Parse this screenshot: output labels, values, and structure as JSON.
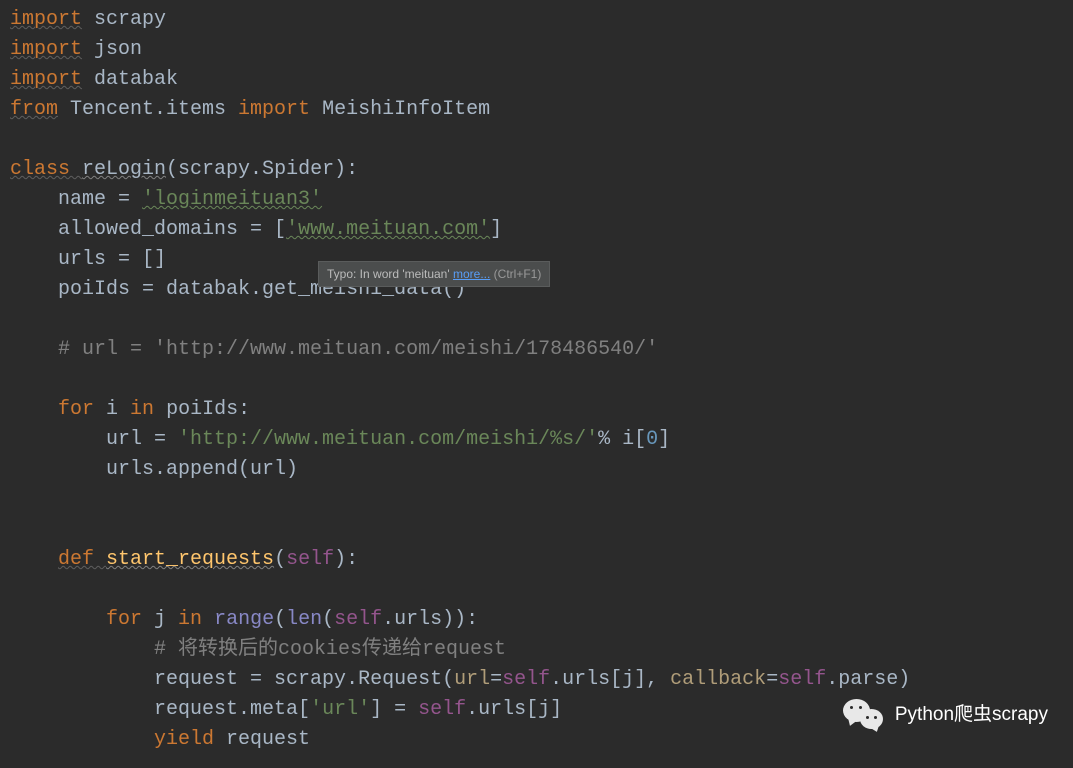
{
  "code": {
    "line1": {
      "kw1": "import",
      "id1": " scrapy"
    },
    "line2": {
      "kw1": "import",
      "id1": " json"
    },
    "line3": {
      "kw1": "import",
      "id1": " databak"
    },
    "line4": {
      "kw1": "from",
      "id1": " Tencent.items ",
      "kw2": "import",
      "id2": " MeishiInfoItem"
    },
    "line6": {
      "kw1": "class ",
      "cls": "reLogin",
      "paren1": "(",
      "base": "scrapy.Spider",
      "paren2": "):"
    },
    "line7": {
      "indent": "    ",
      "var": "name = ",
      "str": "'loginmeituan3'"
    },
    "line8": {
      "indent": "    ",
      "var": "allowed_domains = [",
      "str": "'www.meituan.com'",
      "close": "]"
    },
    "line9": {
      "indent": "    ",
      "var": "urls = []"
    },
    "line10": {
      "indent": "    ",
      "var": "poiIds = databak.get_meishi_data()"
    },
    "line12": {
      "indent": "    ",
      "comment": "# url = 'http://www.meituan.com/meishi/178486540/'"
    },
    "line14": {
      "indent": "    ",
      "kw1": "for ",
      "var1": "i ",
      "kw2": "in ",
      "var2": "poiIds:"
    },
    "line15": {
      "indent": "        ",
      "var": "url = ",
      "str": "'http://www.meituan.com/meishi/%s/'",
      "op": "% i[",
      "num": "0",
      "close": "]"
    },
    "line16": {
      "indent": "        ",
      "var": "urls.append(url)"
    },
    "line19": {
      "indent": "    ",
      "kw1": "def ",
      "fn": "start_requests",
      "paren1": "(",
      "self": "self",
      "paren2": "):"
    },
    "line21": {
      "indent": "        ",
      "kw1": "for ",
      "var1": "j ",
      "kw2": "in ",
      "builtin": "range",
      "paren1": "(",
      "builtin2": "len",
      "paren2": "(",
      "self": "self",
      "attr": ".urls)):"
    },
    "line22": {
      "indent": "            ",
      "comment": "# 将转换后的cookies传递给request"
    },
    "line23": {
      "indent": "            ",
      "var1": "request = scrapy.Request(",
      "kw1": "url",
      "eq1": "=",
      "self1": "self",
      "attr1": ".urls[j]",
      "comma": ", ",
      "kw2": "callback",
      "eq2": "=",
      "self2": "self",
      "attr2": ".parse)"
    },
    "line24": {
      "indent": "            ",
      "var1": "request.meta[",
      "str": "'url'",
      "close1": "] = ",
      "self": "self",
      "attr": ".urls[j]"
    },
    "line25": {
      "indent": "            ",
      "kw1": "yield ",
      "var": "request"
    }
  },
  "tooltip": {
    "prefix": "Typo: In word 'meituan' ",
    "link": "more...",
    "shortcut": " (Ctrl+F1)"
  },
  "watermark": {
    "text": "Python爬虫scrapy"
  }
}
